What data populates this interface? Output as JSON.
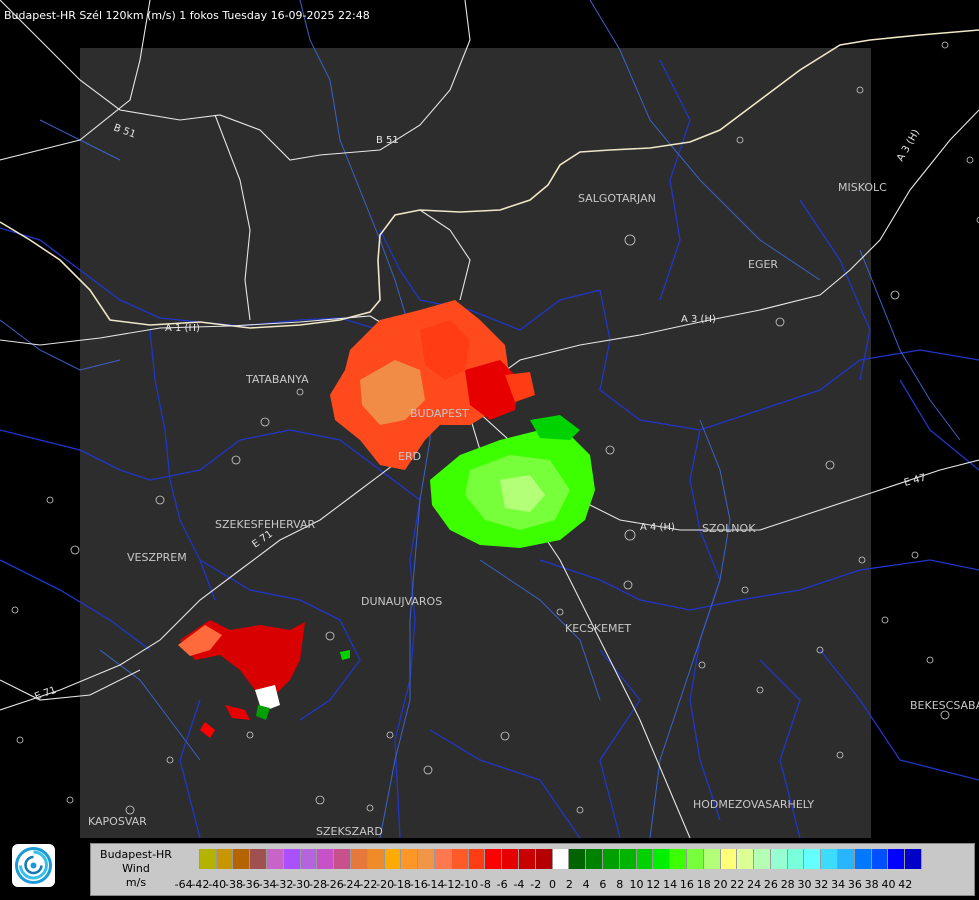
{
  "title": "Budapest-HR Szél 120km (m/s) 1 fokos Tuesday 16-09-2025 22:48",
  "cities": [
    {
      "name": "SALGOTARJAN"
    },
    {
      "name": "MISKOLC"
    },
    {
      "name": "EGER"
    },
    {
      "name": "TATABANYA"
    },
    {
      "name": "BUDAPEST"
    },
    {
      "name": "ERD"
    },
    {
      "name": "SZEKESFEHERVAR"
    },
    {
      "name": "VESZPREM"
    },
    {
      "name": "DUNAUJVAROS"
    },
    {
      "name": "KECSKEMET"
    },
    {
      "name": "SZOLNOK"
    },
    {
      "name": "BEKESCSABA"
    },
    {
      "name": "HODMEZOVASARHELY"
    },
    {
      "name": "KAPOSVAR"
    },
    {
      "name": "SZEKSZARD"
    }
  ],
  "roads": [
    "B 51",
    "B 51",
    "A 1 (H)",
    "A 3 (H)",
    "A 3 (H)",
    "A 4 (H)",
    "E 47",
    "E 71",
    "E 71"
  ],
  "legend": {
    "line1": "Budapest-HR",
    "line2": "Wind",
    "line3": "m/s",
    "ticks": [
      "-64",
      "-42",
      "-40",
      "-38",
      "-36",
      "-34",
      "-32",
      "-30",
      "-28",
      "-26",
      "-24",
      "-22",
      "-20",
      "-18",
      "-16",
      "-14",
      "-12",
      "-10",
      "-8",
      "-6",
      "-4",
      "-2",
      "0",
      "2",
      "4",
      "6",
      "8",
      "10",
      "12",
      "14",
      "16",
      "18",
      "20",
      "22",
      "24",
      "26",
      "28",
      "30",
      "32",
      "34",
      "36",
      "38",
      "40",
      "42"
    ],
    "colors": [
      "#c8c8c8",
      "#b4b400",
      "#c89600",
      "#b46400",
      "#a05050",
      "#c864c8",
      "#aa50ff",
      "#b464dc",
      "#c850c8",
      "#c8508c",
      "#e6783c",
      "#f08c28",
      "#ffaa00",
      "#ff9628",
      "#f09646",
      "#ff7850",
      "#ff5a28",
      "#ff3c14",
      "#ff0000",
      "#e60000",
      "#c80000",
      "#b40000",
      "#ffffff",
      "#006400",
      "#008200",
      "#00a000",
      "#00b400",
      "#00d200",
      "#00f000",
      "#3cff00",
      "#78ff3c",
      "#b4ff78",
      "#ffff78",
      "#dcff96",
      "#b4ffb4",
      "#96ffd2",
      "#78ffdc",
      "#64ffff",
      "#3cdcff",
      "#28b4ff",
      "#0078ff",
      "#0050ff",
      "#0000ff",
      "#0000c8"
    ]
  }
}
